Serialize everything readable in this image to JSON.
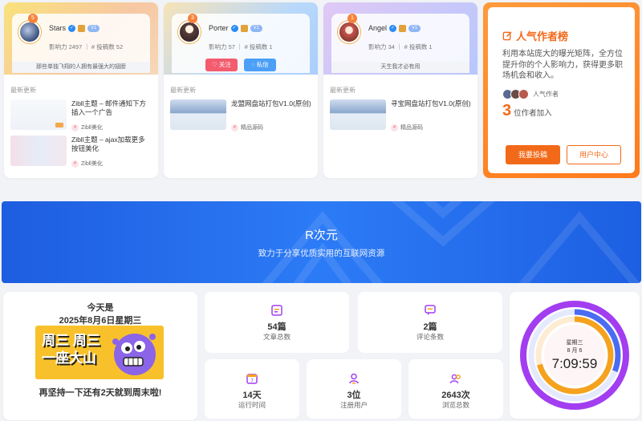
{
  "authors": [
    {
      "name": "Stars",
      "level": "5",
      "pill": "V1",
      "stats": "影响力 2497 ｜ # 投稿数 52",
      "tagline": "那些单独飞翔的人拥有最强大的翅膀",
      "recent_label": "最新更新",
      "posts": [
        {
          "title": "Zibll主题 – 邮件通知下方插入一个广告",
          "category": "Zibll美化"
        },
        {
          "title": "Zibll主题 – ajax加载更多按钮美化",
          "category": "Zibll美化"
        }
      ]
    },
    {
      "name": "Porter",
      "level": "3",
      "pill": "V1",
      "stats": "影响力 57 ｜ # 投稿数 1",
      "follow_label": "关注",
      "message_label": "私信",
      "recent_label": "最新更新",
      "posts": [
        {
          "title": "龙盟网盘站打包V1.0(原创)",
          "category": "精品源码"
        }
      ]
    },
    {
      "name": "Angel",
      "level": "1",
      "pill": "V1",
      "stats": "影响力 34 ｜ # 投稿数 1",
      "tagline": "天生我才必有用",
      "recent_label": "最新更新",
      "posts": [
        {
          "title": "寻宝网盘站打包V1.0(原创)",
          "category": "精品源码"
        }
      ]
    }
  ],
  "popular": {
    "title": "人气作者榜",
    "description": "利用本站庞大的曝光矩阵，全方位提升你的个人影响力，获得更多职场机会和收入。",
    "avatars_label": "人气作者",
    "count": "3",
    "count_label": "位作者加入",
    "submit_label": "我要投稿",
    "center_label": "用户中心"
  },
  "banner": {
    "title": "R次元",
    "subtitle": "致力于分享优质实用的互联网资源"
  },
  "today": {
    "line1": "今天是",
    "line2": "2025年8月6日星期三",
    "image_text_1": "周三 周三",
    "image_text_2": "一座大山",
    "footer": "再坚持一下还有2天就到周末啦!"
  },
  "stats": {
    "articles": {
      "value": "54篇",
      "label": "文章总数"
    },
    "comments": {
      "value": "2篇",
      "label": "评论条数"
    },
    "runtime": {
      "value": "14天",
      "label": "运行时间"
    },
    "users": {
      "value": "3位",
      "label": "注册用户"
    },
    "views": {
      "value": "2643次",
      "label": "浏览总数"
    }
  },
  "clock": {
    "weekday": "星期三",
    "date": "8 月 6",
    "time": "7:09:59"
  },
  "colors": {
    "accent_orange": "#f26a19",
    "banner_blue": "#2c7bf6",
    "ring_purple": "#a23ef0",
    "ring_blue": "#4a6cf2",
    "ring_orange": "#f5a21e"
  }
}
